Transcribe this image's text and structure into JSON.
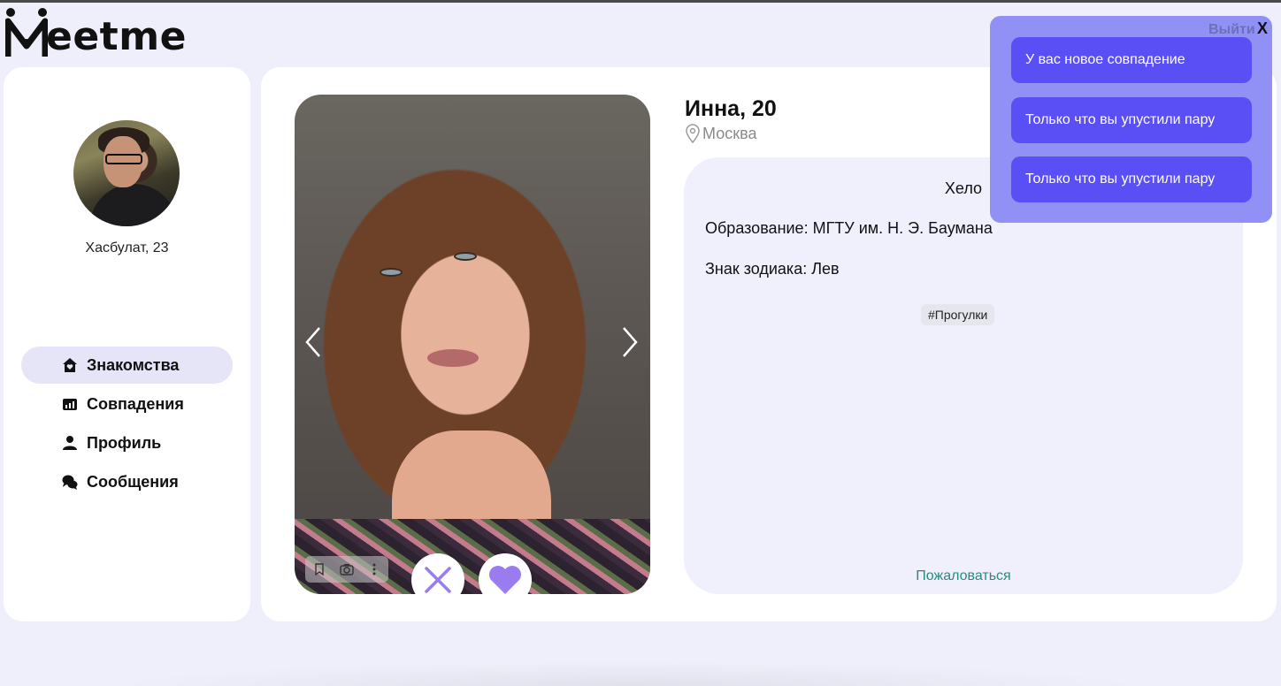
{
  "app": {
    "logo_first": "M",
    "logo_rest": "eetme"
  },
  "sidebar": {
    "user_name": "Хасбулат, 23",
    "items": [
      {
        "label": "Знакомства",
        "icon": "home-heart-icon",
        "active": true
      },
      {
        "label": "Совпадения",
        "icon": "chart-icon",
        "active": false
      },
      {
        "label": "Профиль",
        "icon": "user-icon",
        "active": false
      },
      {
        "label": "Сообщения",
        "icon": "chat-icon",
        "active": false
      }
    ]
  },
  "profile": {
    "name": "Инна, 20",
    "city": "Москва",
    "bio": "Хело",
    "education": "Образование: МГТУ им. Н. Э. Баумана",
    "zodiac": "Знак зодиака: Лев",
    "tags": [
      "#Прогулки"
    ],
    "report_label": "Пожаловаться"
  },
  "header": {
    "logout_label": "Выйти",
    "close_label": "X"
  },
  "notifications": [
    "У вас новое совпадение",
    "Только что вы упустили пару",
    "Только что вы упустили пару"
  ],
  "colors": {
    "accent": "#5a4ff5",
    "panel": "#9090f5",
    "background": "#efeffb",
    "like": "#9a7cf0",
    "report": "#2a8a7e"
  }
}
